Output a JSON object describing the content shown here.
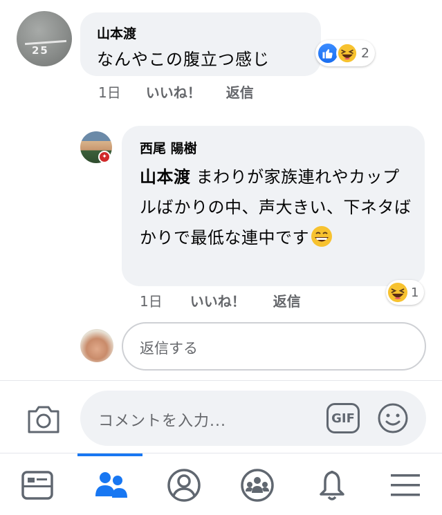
{
  "comment1": {
    "author": "山本渡",
    "text": "なんやこの腹立つ感じ",
    "avatar_label": "25",
    "reaction_count": "2",
    "time": "1日",
    "like_label": "いいね！",
    "reply_label": "返信"
  },
  "reply": {
    "author": "西尾 陽樹",
    "mention": "山本渡",
    "text": " まわりが家族連れやカップルばかりの中、声大きい、下ネタばかりで最低な連中です",
    "reaction_count": "1",
    "time": "1日",
    "like_label": "いいね！",
    "reply_label": "返信"
  },
  "reply_input": {
    "placeholder": "返信する"
  },
  "composer": {
    "placeholder": "コメントを入力...",
    "gif_label": "GIF"
  },
  "nav": {
    "items": [
      {
        "icon": "news-feed-icon"
      },
      {
        "icon": "groups-icon",
        "active": true
      },
      {
        "icon": "profile-icon"
      },
      {
        "icon": "community-icon"
      },
      {
        "icon": "bell-icon"
      },
      {
        "icon": "menu-icon"
      }
    ]
  },
  "colors": {
    "accent": "#1877f2",
    "bubble": "#f0f2f5",
    "muted": "#65676b"
  }
}
